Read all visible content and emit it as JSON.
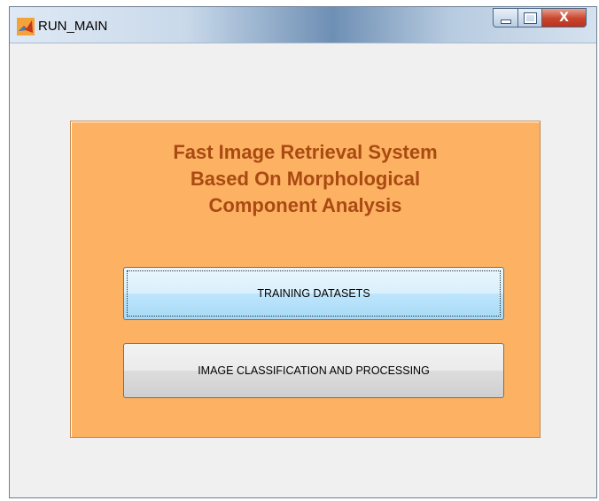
{
  "window": {
    "title": "RUN_MAIN",
    "close_glyph": "X",
    "icon": "matlab-icon"
  },
  "panel": {
    "heading_lines": [
      "Fast Image Retrieval System",
      "Based On Morphological",
      "Component Analysis"
    ]
  },
  "buttons": {
    "training": "TRAINING DATASETS",
    "classification": "IMAGE CLASSIFICATION AND PROCESSING"
  },
  "colors": {
    "panel_bg": "#fdb263",
    "heading": "#a94a12",
    "close_button": "#c9452c"
  }
}
